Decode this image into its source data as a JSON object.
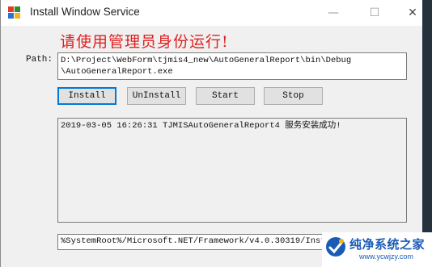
{
  "window": {
    "title": "Install Window Service",
    "controls": {
      "minimize": "—",
      "maximize": "☐",
      "close": "✕"
    }
  },
  "warning_text": "请使用管理员身份运行!",
  "path": {
    "label": "Path:",
    "value": "D:\\Project\\WebForm\\tjmis4_new\\AutoGeneralReport\\bin\\Debug\n\\AutoGeneralReport.exe"
  },
  "buttons": {
    "install": "Install",
    "uninstall": "UnInstall",
    "start": "Start",
    "stop": "Stop"
  },
  "log": {
    "text": "2019-03-05 16:26:31 TJMISAutoGeneralReport4 服务安装成功!"
  },
  "status": {
    "text": "%SystemRoot%/Microsoft.NET/Framework/v4.0.30319/InstallUtil.exe"
  },
  "watermark": {
    "title": "纯净系统之家",
    "url": "www.ycwjzy.com"
  },
  "colors": {
    "warning": "#e02020",
    "default_button_border": "#0078d7",
    "watermark": "#1a5bb5"
  }
}
